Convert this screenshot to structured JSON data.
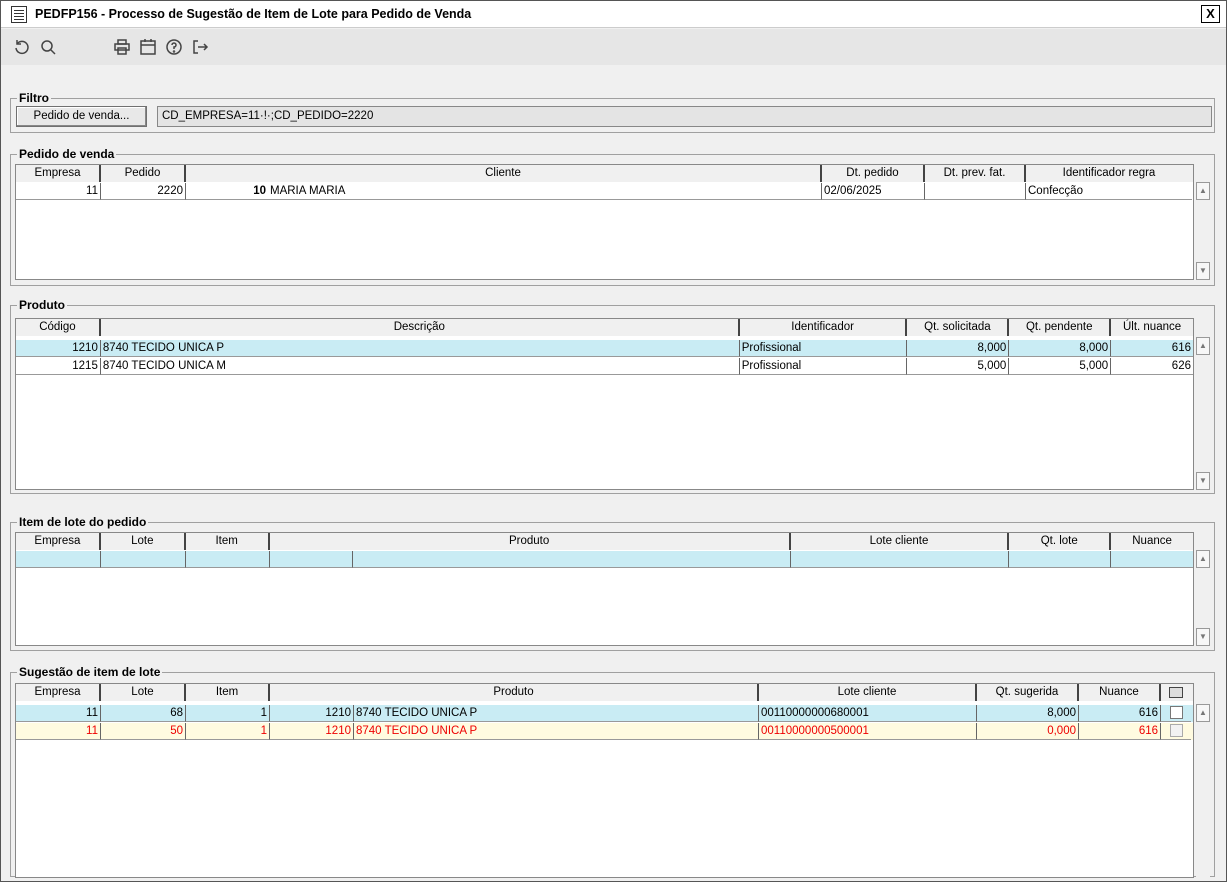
{
  "window": {
    "title": "PEDFP156 - Processo de Sugestão de Item de Lote para Pedido de Venda",
    "close_label": "X"
  },
  "filtro": {
    "legend": "Filtro",
    "button_label": "Pedido de venda...",
    "value": "CD_EMPRESA=11·!·;CD_PEDIDO=2220"
  },
  "pedido": {
    "legend": "Pedido de venda",
    "columns": [
      "Empresa",
      "Pedido",
      "Cliente",
      "Dt. pedido",
      "Dt. prev. fat.",
      "Identificador regra"
    ],
    "rows": [
      {
        "empresa": "11",
        "pedido": "2220",
        "cliente_cod": "10",
        "cliente_nome": "MARIA MARIA",
        "dt_pedido": "02/06/2025",
        "dt_prev": "",
        "regra": "Confecção"
      }
    ]
  },
  "produto": {
    "legend": "Produto",
    "columns": [
      "Código",
      "Descrição",
      "Identificador",
      "Qt. solicitada",
      "Qt. pendente",
      "Últ. nuance"
    ],
    "rows": [
      {
        "codigo": "1210",
        "descricao": "8740 TECIDO UNICA P",
        "identificador": "Profissional",
        "qt_solicitada": "8,000",
        "qt_pendente": "8,000",
        "nuance": "616"
      },
      {
        "codigo": "1215",
        "descricao": "8740 TECIDO UNICA M",
        "identificador": "Profissional",
        "qt_solicitada": "5,000",
        "qt_pendente": "5,000",
        "nuance": "626"
      }
    ]
  },
  "item_lote": {
    "legend": "Item de lote do pedido",
    "columns": [
      "Empresa",
      "Lote",
      "Item",
      "Produto",
      "Lote cliente",
      "Qt. lote",
      "Nuance"
    ]
  },
  "sugestao": {
    "legend": "Sugestão de item de lote",
    "columns": [
      "Empresa",
      "Lote",
      "Item",
      "Produto",
      "Lote cliente",
      "Qt. sugerida",
      "Nuance"
    ],
    "rows": [
      {
        "empresa": "11",
        "lote": "68",
        "item": "1",
        "prod_cod": "1210",
        "prod_desc": "8740 TECIDO UNICA P",
        "lote_cliente": "00110000000680001",
        "qt": "8,000",
        "nuance": "616"
      },
      {
        "empresa": "11",
        "lote": "50",
        "item": "1",
        "prod_cod": "1210",
        "prod_desc": "8740 TECIDO UNICA P",
        "lote_cliente": "00110000000500001",
        "qt": "0,000",
        "nuance": "616"
      }
    ]
  },
  "icons": {
    "undo": "undo-icon",
    "search": "search-icon",
    "print": "print-icon",
    "calendar": "calendar-icon",
    "help": "help-icon",
    "exit": "exit-icon"
  },
  "colors": {
    "selected_row": "#c9ecf4",
    "highlight_row": "#fffbe0",
    "highlight_text": "#e00000"
  }
}
